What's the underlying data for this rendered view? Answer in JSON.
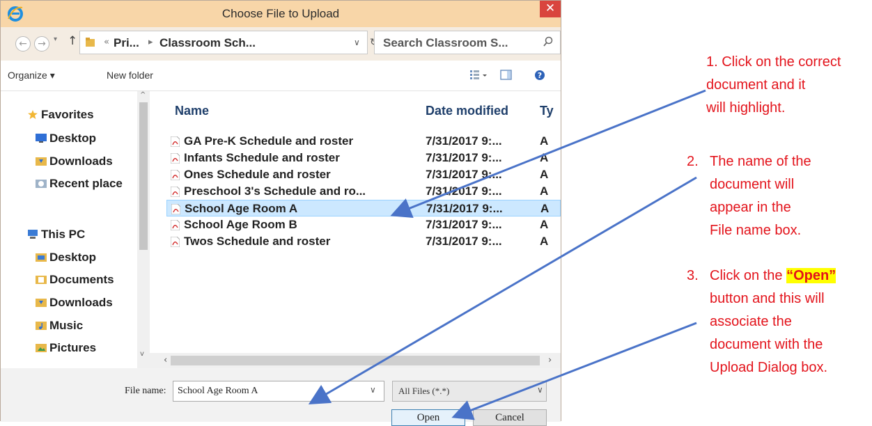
{
  "window": {
    "title": "Choose File to Upload",
    "close_label": "✕"
  },
  "address": {
    "crumbs": [
      "« ",
      "Pri...",
      "Classroom Sch..."
    ],
    "search_placeholder": "Search Classroom S..."
  },
  "commands": {
    "organize": "Organize ▾",
    "new_folder": "New folder"
  },
  "nav": {
    "favorites": "Favorites",
    "fav_items": [
      "Desktop",
      "Downloads",
      "Recent place"
    ],
    "this_pc": "This PC",
    "pc_items": [
      "Desktop",
      "Documents",
      "Downloads",
      "Music",
      "Pictures"
    ]
  },
  "columns": {
    "name": "Name",
    "date": "Date modified",
    "type": "Ty"
  },
  "files": [
    {
      "name": "GA Pre-K Schedule and roster",
      "date": "7/31/2017 9:...",
      "type": "A"
    },
    {
      "name": "Infants Schedule and roster",
      "date": "7/31/2017 9:...",
      "type": "A"
    },
    {
      "name": "Ones Schedule and roster",
      "date": "7/31/2017 9:...",
      "type": "A"
    },
    {
      "name": "Preschool 3's Schedule and ro...",
      "date": "7/31/2017 9:...",
      "type": "A"
    },
    {
      "name": "School Age Room A",
      "date": "7/31/2017 9:...",
      "type": "A"
    },
    {
      "name": "School Age Room B",
      "date": "7/31/2017 9:...",
      "type": "A"
    },
    {
      "name": "Twos Schedule and roster",
      "date": "7/31/2017 9:...",
      "type": "A"
    }
  ],
  "selected_file": "School Age Room A",
  "bottom": {
    "file_name_label": "File name:",
    "file_name_value": "School Age Room A",
    "file_type": "All Files (*.*)",
    "open": "Open",
    "cancel": "Cancel"
  },
  "notes": {
    "n1_line1": "1. Click on the correct",
    "n1_line2": "document and it",
    "n1_line3": "will highlight.",
    "n2_num": "2.",
    "n2_line1": "The name of the",
    "n2_line2": "document will",
    "n2_line3": "appear in the",
    "n2_line4": "File name box.",
    "n3_num": "3.",
    "n3_pre": "Click on the ",
    "n3_hl": "“Open”",
    "n3_line2": "button and this will",
    "n3_line3": "associate the",
    "n3_line4": "document with the",
    "n3_line5": "Upload Dialog box."
  },
  "colors": {
    "title_bar": "#f8d6a8",
    "note_text": "#e3131b",
    "arrow": "#4a73c8",
    "selection": "#cce8ff"
  }
}
